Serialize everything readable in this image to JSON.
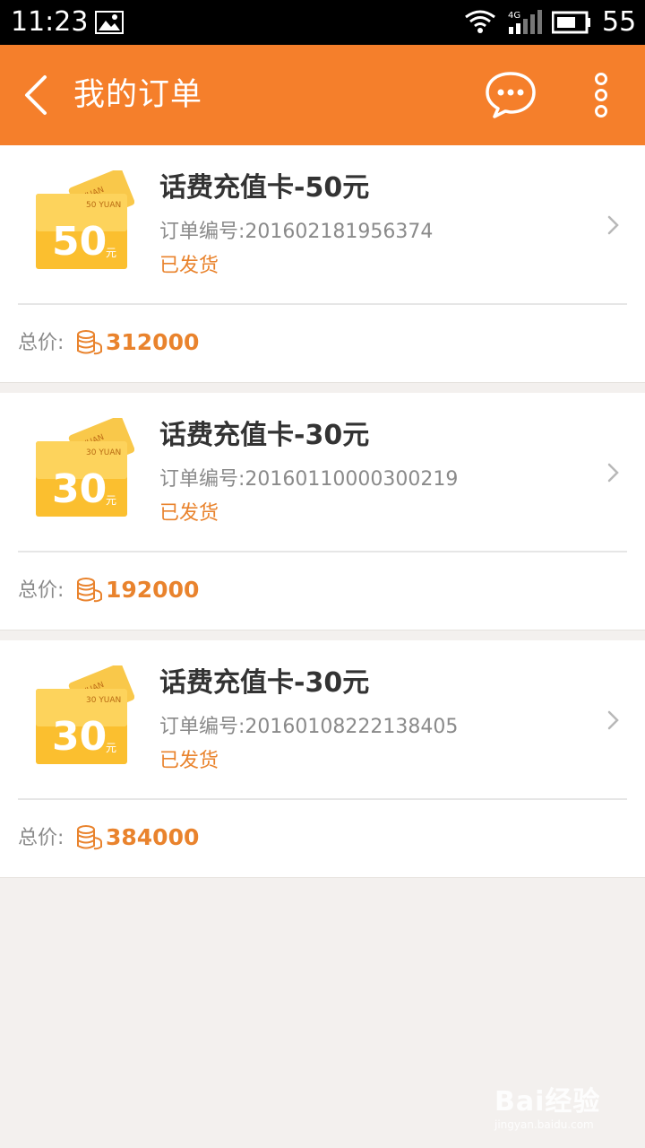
{
  "statusbar": {
    "time": "11:23",
    "network": "4G",
    "battery": "55"
  },
  "header": {
    "title": "我的订单",
    "back_icon": "chevron-left-icon",
    "chat_icon": "chat-bubble-icon",
    "more_icon": "more-vertical-icon"
  },
  "price_label": "总价:",
  "orders": [
    {
      "name": "话费充值卡-50元",
      "order_no": "订单编号:201602181956374",
      "status": "已发货",
      "price": "312000",
      "card_value": "50",
      "card_unit": "元",
      "card_caption": "50 YUAN",
      "card_back": "YUAN"
    },
    {
      "name": "话费充值卡-30元",
      "order_no": "订单编号:20160110000300219",
      "status": "已发货",
      "price": "192000",
      "card_value": "30",
      "card_unit": "元",
      "card_caption": "30 YUAN",
      "card_back": "YUAN"
    },
    {
      "name": "话费充值卡-30元",
      "order_no": "订单编号:20160108222138405",
      "status": "已发货",
      "price": "384000",
      "card_value": "30",
      "card_unit": "元",
      "card_caption": "30 YUAN",
      "card_back": "YUAN"
    }
  ],
  "watermark": {
    "brand": "Bai经验",
    "url": "jingyan.baidu.com"
  },
  "colors": {
    "accent": "#f57f2b",
    "price": "#e9832d",
    "background": "#f3f0ee"
  }
}
